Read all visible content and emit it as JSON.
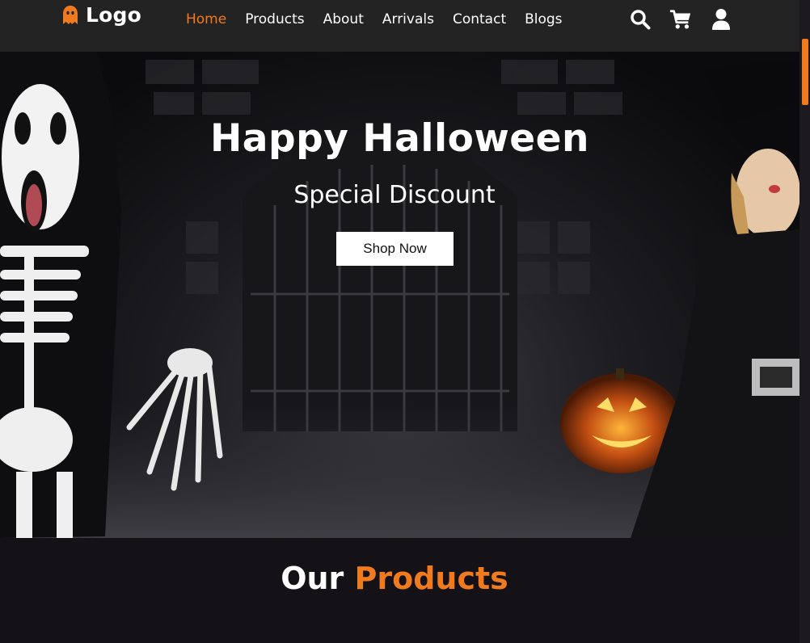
{
  "header": {
    "logo_text": "Logo",
    "nav": [
      {
        "label": "Home",
        "active": true
      },
      {
        "label": "Products",
        "active": false
      },
      {
        "label": "About",
        "active": false
      },
      {
        "label": "Arrivals",
        "active": false
      },
      {
        "label": "Contact",
        "active": false
      },
      {
        "label": "Blogs",
        "active": false
      }
    ],
    "icons": [
      "search-icon",
      "cart-icon",
      "user-icon"
    ]
  },
  "hero": {
    "title": "Happy Halloween",
    "subtitle": "Special Discount",
    "button_label": "Shop Now"
  },
  "products_section": {
    "title_part1": "Our",
    "title_part2": "Products"
  },
  "colors": {
    "accent": "#f07a1e",
    "header_bg": "#232323",
    "page_bg": "#141216"
  }
}
